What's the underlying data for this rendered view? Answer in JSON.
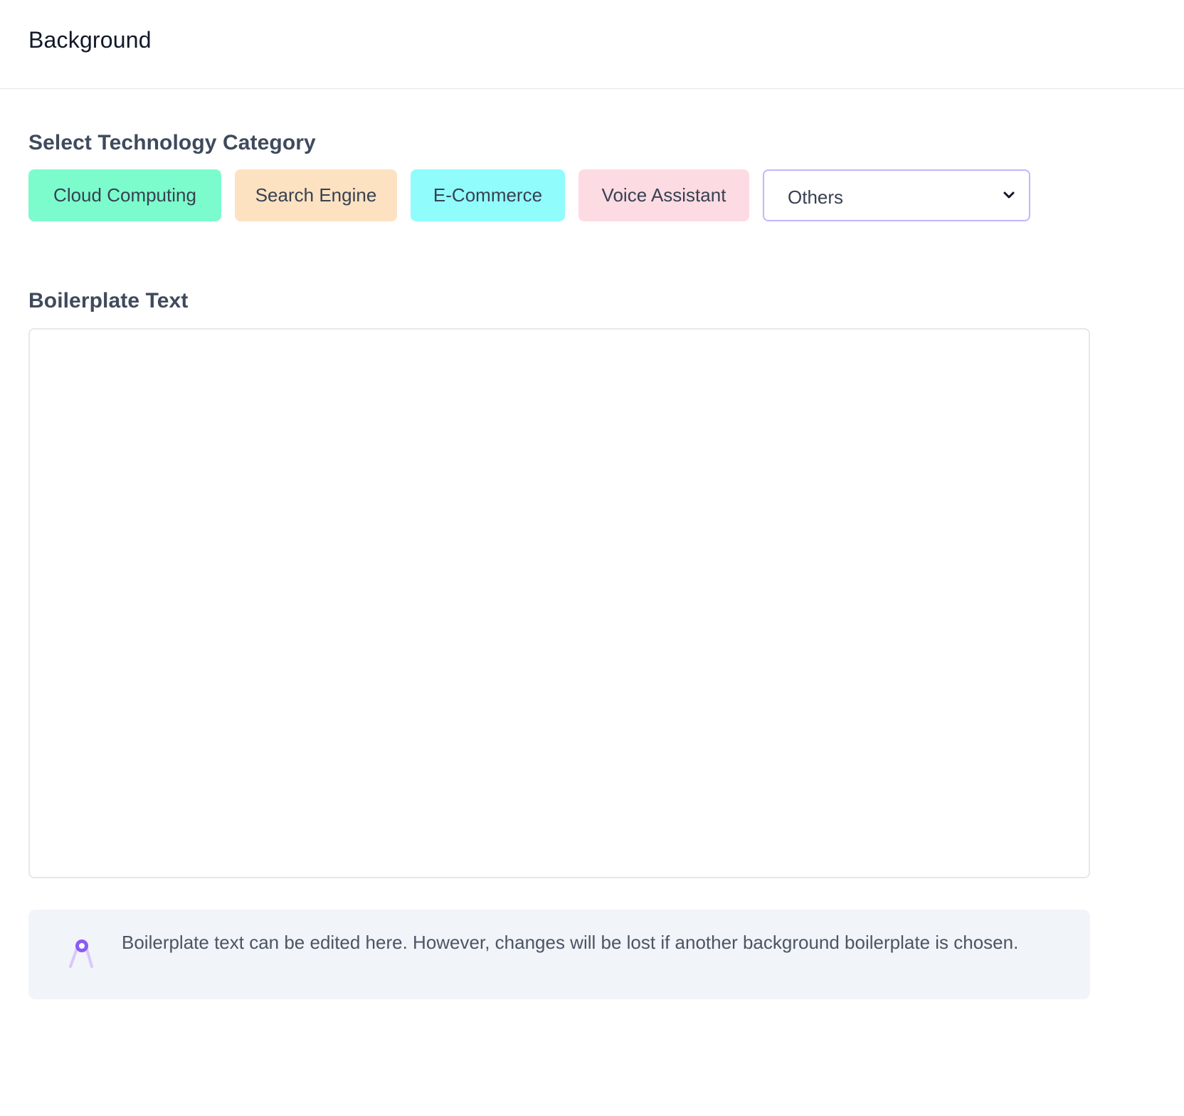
{
  "header": {
    "title": "Background"
  },
  "category": {
    "heading": "Select Technology Category",
    "chips": [
      {
        "label": "Cloud Computing",
        "color": "#7cfccc"
      },
      {
        "label": "Search Engine",
        "color": "#fde2c2"
      },
      {
        "label": "E-Commerce",
        "color": "#90fcfc"
      },
      {
        "label": "Voice Assistant",
        "color": "#fddbe2"
      }
    ],
    "dropdown": {
      "selected": "Others",
      "icon": "chevron-down-icon"
    }
  },
  "boilerplate": {
    "heading": "Boilerplate Text",
    "value": ""
  },
  "notice": {
    "icon": "compass-icon",
    "text": "Boilerplate text can be edited here. However, changes will be lost if another background boilerplate is chosen."
  },
  "colors": {
    "accent": "#8b5cf6",
    "dropdown_border": "#c4b5fd",
    "notice_bg": "#f1f4f8"
  }
}
